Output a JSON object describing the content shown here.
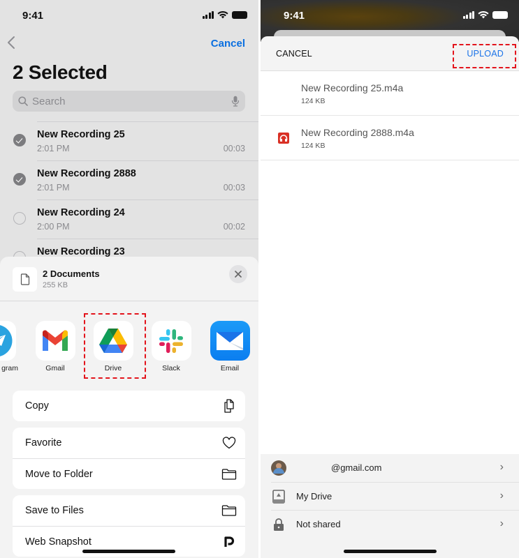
{
  "left": {
    "status_bar": {
      "time": "9:41"
    },
    "nav": {
      "back_icon": "chevron-left-icon",
      "cancel_label": "Cancel"
    },
    "title": "2 Selected",
    "search": {
      "placeholder": "Search",
      "value": ""
    },
    "recordings": [
      {
        "name": "New Recording 25",
        "time": "2:01 PM",
        "duration": "00:03",
        "selected": true
      },
      {
        "name": "New Recording 2888",
        "time": "2:01 PM",
        "duration": "00:03",
        "selected": true
      },
      {
        "name": "New Recording 24",
        "time": "2:00 PM",
        "duration": "00:02",
        "selected": false
      },
      {
        "name": "New Recording 23",
        "time": "",
        "duration": "",
        "selected": false
      }
    ],
    "share_sheet": {
      "doc_title": "2 Documents",
      "doc_size": "255 KB",
      "apps": [
        {
          "label": "gram",
          "icon": "telegram-icon"
        },
        {
          "label": "Gmail",
          "icon": "gmail-icon"
        },
        {
          "label": "Drive",
          "icon": "google-drive-icon",
          "highlighted": true
        },
        {
          "label": "Slack",
          "icon": "slack-icon"
        },
        {
          "label": "Email",
          "icon": "email-icon"
        }
      ],
      "action_groups": [
        [
          {
            "label": "Copy",
            "icon": "copy-icon"
          }
        ],
        [
          {
            "label": "Favorite",
            "icon": "heart-icon"
          },
          {
            "label": "Move to Folder",
            "icon": "folder-icon"
          }
        ],
        [
          {
            "label": "Save to Files",
            "icon": "folder-icon"
          },
          {
            "label": "Web Snapshot",
            "icon": "pocket-p-icon"
          }
        ]
      ]
    }
  },
  "right": {
    "status_bar": {
      "time": "9:41"
    },
    "header": {
      "cancel_label": "CANCEL",
      "upload_label": "UPLOAD"
    },
    "files": [
      {
        "name": "New Recording 25.m4a",
        "size": "124 KB",
        "has_icon": false
      },
      {
        "name": "New Recording 2888.m4a",
        "size": "124 KB",
        "has_icon": true
      }
    ],
    "destination": {
      "account": "@gmail.com",
      "folder": "My Drive",
      "sharing": "Not shared"
    }
  },
  "colors": {
    "ios_blue": "#0a6fe0",
    "google_blue": "#1a73e8",
    "highlight_red": "#e3141c",
    "file_icon_red": "#d93025"
  }
}
